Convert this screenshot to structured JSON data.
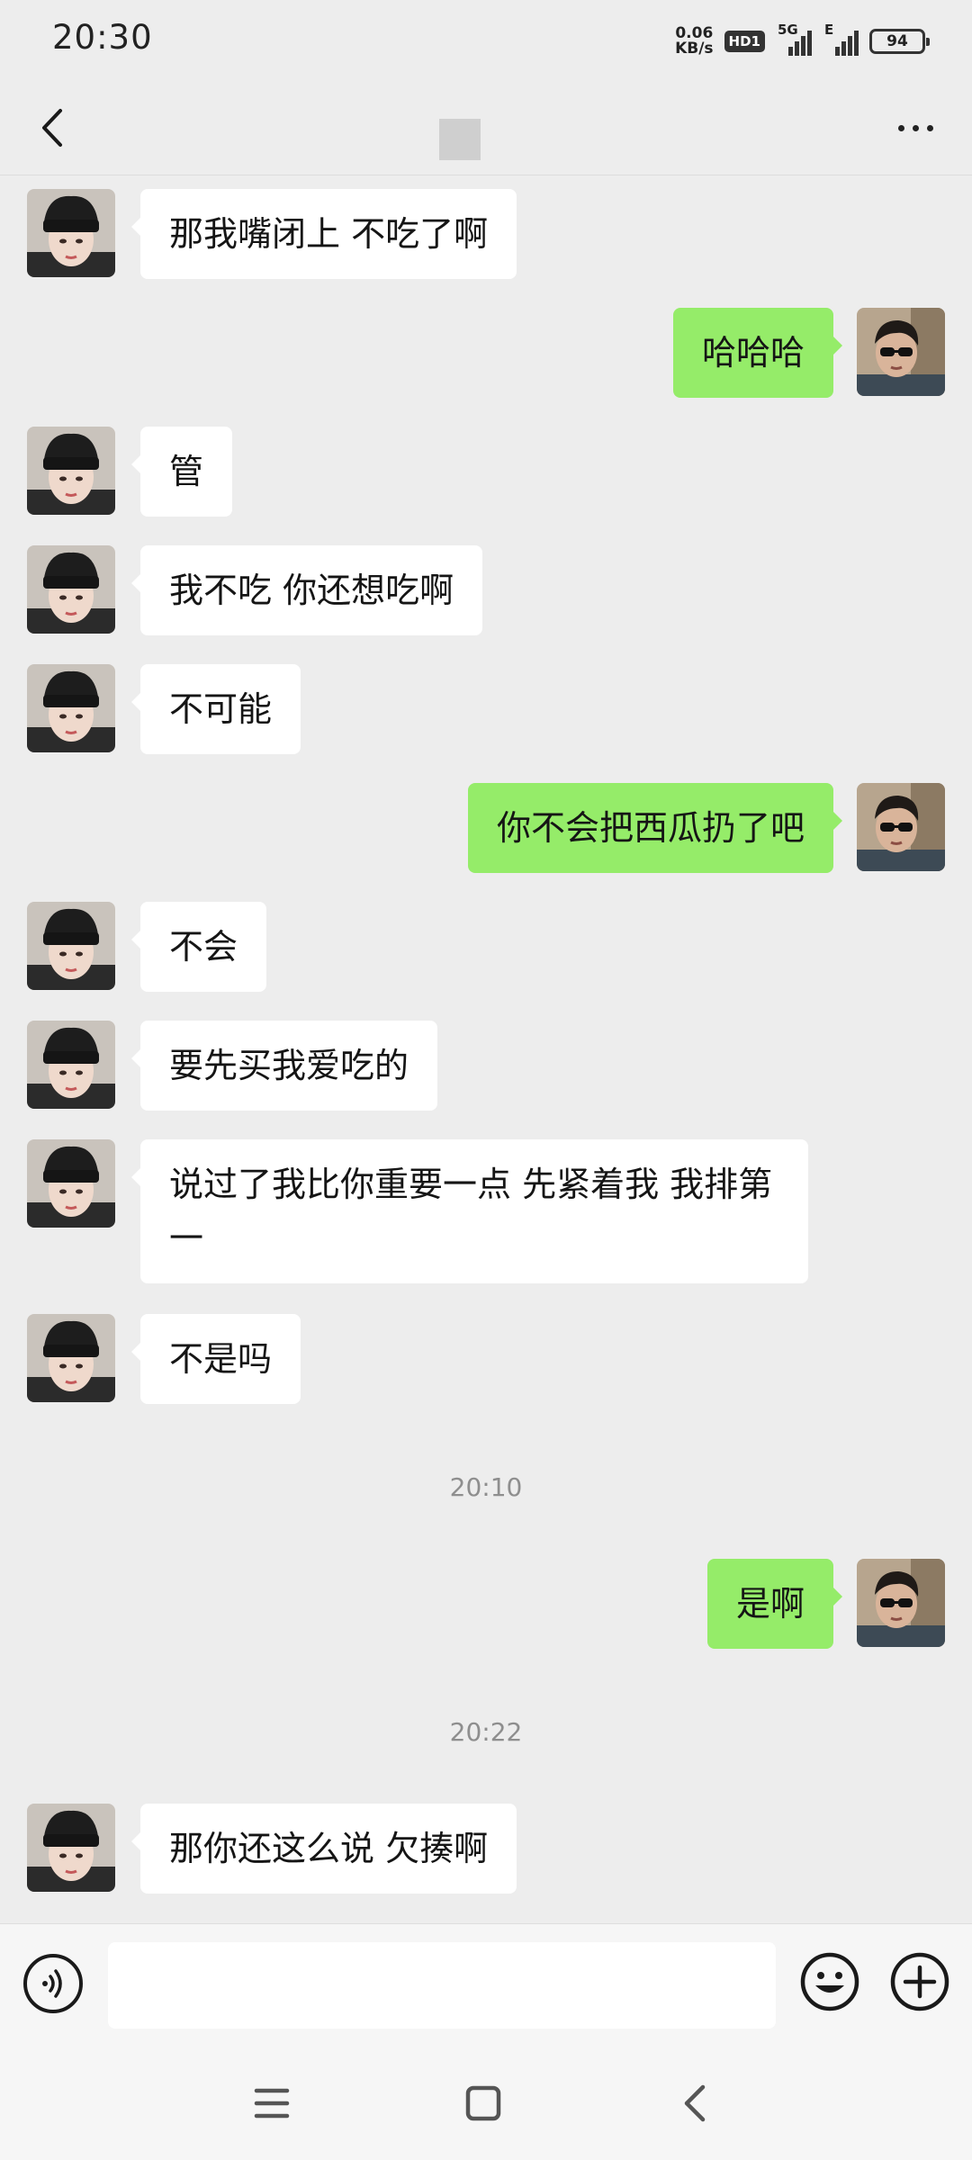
{
  "status_bar": {
    "time": "20:30",
    "net_speed_value": "0.06",
    "net_speed_unit": "KB/s",
    "hd_badge": "HD1",
    "signal_1_label": "5G",
    "signal_2_label": "E",
    "battery": "94"
  },
  "messages": [
    {
      "side": "in",
      "text": "那我嘴闭上 不吃了啊"
    },
    {
      "side": "out",
      "text": "哈哈哈"
    },
    {
      "side": "in",
      "text": "管"
    },
    {
      "side": "in",
      "text": "我不吃 你还想吃啊"
    },
    {
      "side": "in",
      "text": "不可能"
    },
    {
      "side": "out",
      "text": "你不会把西瓜扔了吧"
    },
    {
      "side": "in",
      "text": "不会"
    },
    {
      "side": "in",
      "text": "要先买我爱吃的"
    },
    {
      "side": "in",
      "text": "说过了我比你重要一点 先紧着我 我排第一"
    },
    {
      "side": "in",
      "text": "不是吗"
    },
    {
      "side": "out",
      "text": "是啊"
    },
    {
      "side": "in",
      "text": "那你还这么说 欠揍啊"
    }
  ],
  "timestamps": [
    "20:10",
    "20:22"
  ],
  "input": {
    "value": "",
    "placeholder": ""
  },
  "icons": {
    "back": "chevron-left-icon",
    "more": "more-dots-icon",
    "voice": "voice-icon",
    "emoji": "emoji-icon",
    "plus": "plus-icon",
    "recents": "menu-icon",
    "home": "home-square-icon",
    "system_back": "system-back-icon"
  },
  "colors": {
    "background": "#ededed",
    "outgoing_bubble": "#95ec69",
    "incoming_bubble": "#ffffff",
    "timestamp_text": "#8e8e8e"
  }
}
